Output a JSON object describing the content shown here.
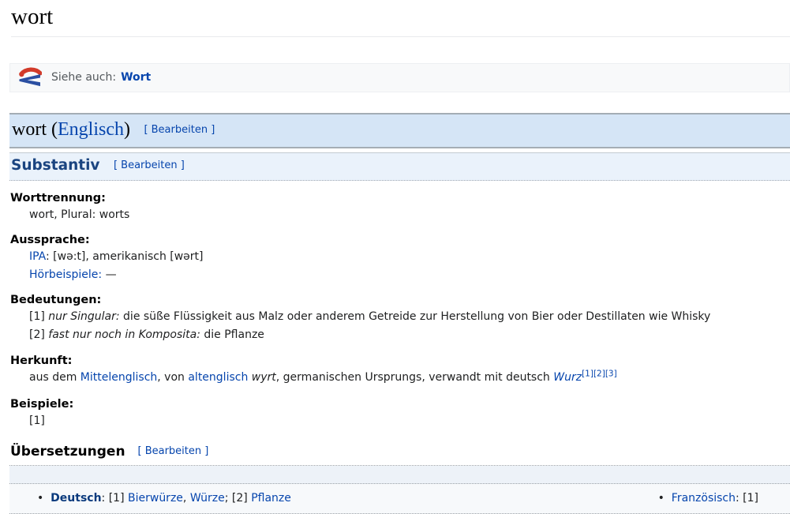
{
  "page": {
    "title": "wort"
  },
  "siehe": {
    "label": "Siehe auch:",
    "link": "Wort"
  },
  "lang_header": {
    "word_open": "wort (",
    "lang": "Englisch",
    "word_close": ")",
    "edit": "[ Bearbeiten ]"
  },
  "pos_header": {
    "title": "Substantiv",
    "edit": "[ Bearbeiten ]"
  },
  "worttrennung": {
    "label": "Worttrennung:",
    "text": "wort, Plural: worts"
  },
  "aussprache": {
    "label": "Aussprache:",
    "ipa_link": "IPA",
    "ipa_rest": ": [wə:t], amerikanisch [wərt]",
    "hoer_link": "Hörbeispiele:",
    "hoer_rest": " —"
  },
  "bedeutungen": {
    "label": "Bedeutungen:",
    "item1_num": "[1] ",
    "item1_qualifier": "nur Singular:",
    "item1_text": " die süße Flüssigkeit aus Malz oder anderem Getreide zur Herstellung von Bier oder Destillaten wie Whisky",
    "item2_num": "[2] ",
    "item2_qualifier": "fast nur noch in Komposita:",
    "item2_text": " die Pflanze"
  },
  "herkunft": {
    "label": "Herkunft:",
    "s1": "aus dem ",
    "link1": "Mittelenglisch",
    "s2": ", von ",
    "link2": "altenglisch",
    "s3": " ",
    "italic1": "wyrt",
    "s4": ", germanischen Ursprungs, verwandt mit deutsch ",
    "link3": "Wurz",
    "sup1": "[1]",
    "sup2": "[2]",
    "sup3": "[3]"
  },
  "beispiele": {
    "label": "Beispiele:",
    "item": "[1]"
  },
  "uebersetzungen": {
    "label": "Übersetzungen",
    "edit": "[ Bearbeiten ]",
    "de_lang": "Deutsch",
    "de_s1": ": [1] ",
    "de_link1": "Bierwürze",
    "de_s2": ", ",
    "de_link2": "Würze",
    "de_s3": "; [2] ",
    "de_link3": "Pflanze",
    "fr_lang": "Französisch",
    "fr_s1": ": [1]"
  },
  "colors": {
    "link": "#0645ad",
    "pos_heading": "#1a4480",
    "h2_band_bg": "#d5e5f6",
    "h3_band_bg": "#eaf2fb",
    "siehe_box_bg": "#f8f9fa",
    "icon_red": "#d23b2a",
    "icon_blue": "#2b4fa2"
  }
}
